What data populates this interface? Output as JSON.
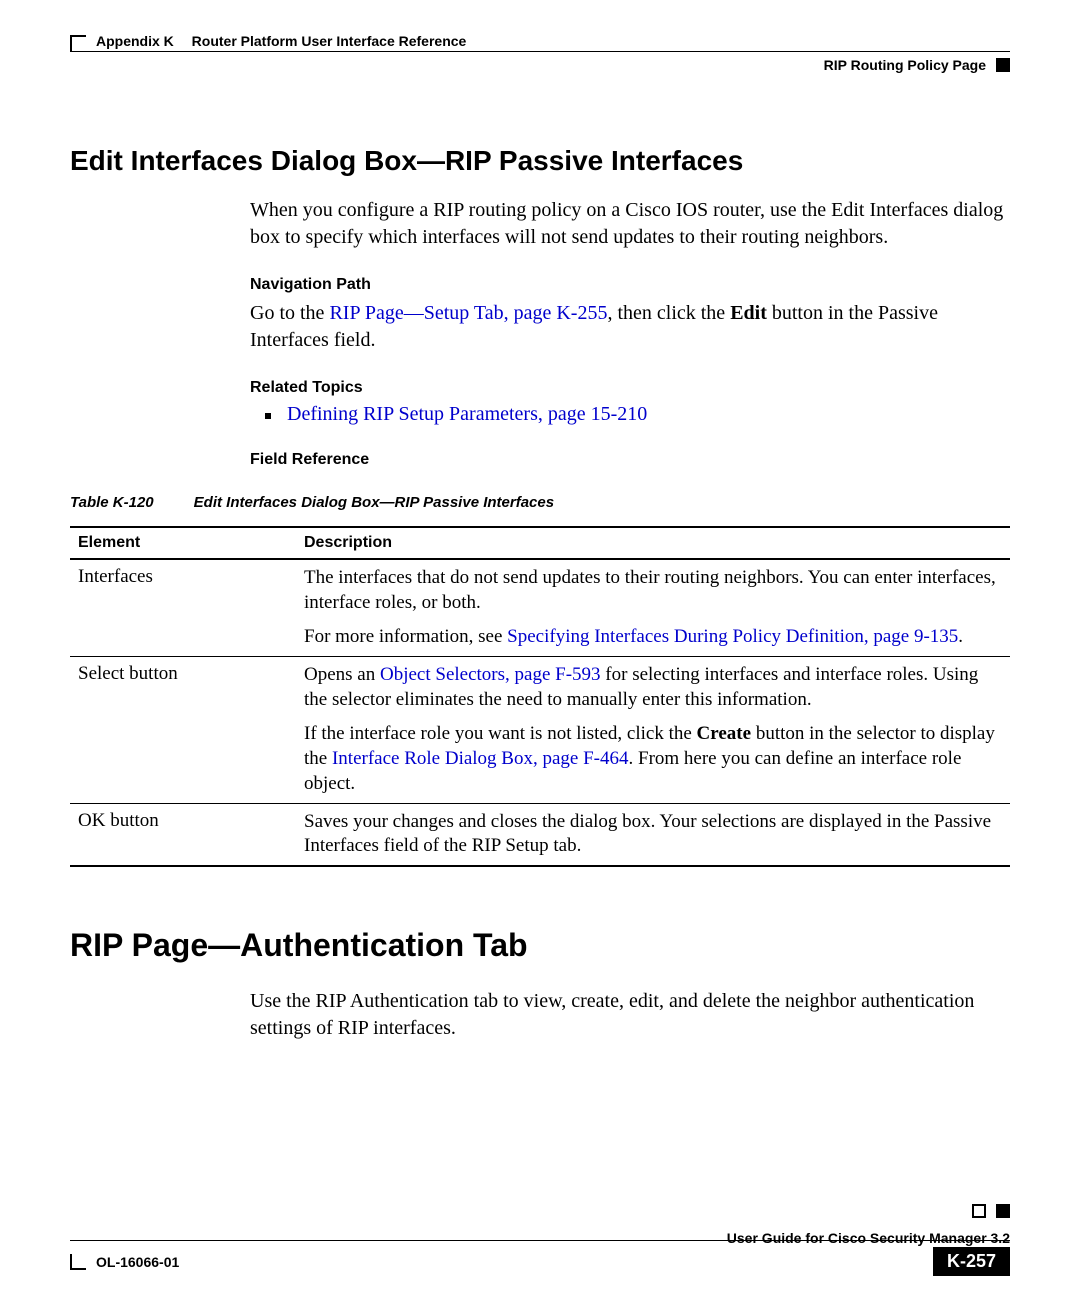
{
  "header": {
    "appendix": "Appendix K  Router Platform User Interface Reference",
    "section": "RIP Routing Policy Page"
  },
  "section1": {
    "heading": "Edit Interfaces Dialog Box—RIP Passive Interfaces",
    "intro": "When you configure a RIP routing policy on a Cisco IOS router, use the Edit Interfaces dialog box to specify which interfaces will not send updates to their routing neighbors.",
    "nav_path_label": "Navigation Path",
    "nav_prefix": "Go to the ",
    "nav_link": "RIP Page—Setup Tab, page K-255",
    "nav_mid": ", then click the ",
    "nav_bold": "Edit",
    "nav_suffix": " button in the Passive Interfaces field.",
    "related_label": "Related Topics",
    "related_link": "Defining RIP Setup Parameters, page 15-210",
    "field_ref_label": "Field Reference",
    "table_num": "Table K-120",
    "table_title": "Edit Interfaces Dialog Box—RIP Passive Interfaces"
  },
  "table": {
    "col1": "Element",
    "col2": "Description",
    "rows": [
      {
        "elem": "Interfaces",
        "p1": "The interfaces that do not send updates to their routing neighbors. You can enter interfaces, interface roles, or both.",
        "p2a": "For more information, see ",
        "p2link": "Specifying Interfaces During Policy Definition, page 9-135",
        "p2b": "."
      },
      {
        "elem": "Select button",
        "p1a": "Opens an ",
        "p1link": "Object Selectors, page F-593",
        "p1b": " for selecting interfaces and interface roles. Using the selector eliminates the need to manually enter this information.",
        "p2a": "If the interface role you want is not listed, click the ",
        "p2bold": "Create",
        "p2b": " button in the selector to display the ",
        "p2link": "Interface Role Dialog Box, page F-464",
        "p2c": ". From here you can define an interface role object."
      },
      {
        "elem": "OK button",
        "p1": "Saves your changes and closes the dialog box. Your selections are displayed in the Passive Interfaces field of the RIP Setup tab."
      }
    ]
  },
  "section2": {
    "heading": "RIP Page—Authentication Tab",
    "intro": "Use the RIP Authentication tab to view, create, edit, and delete the neighbor authentication settings of RIP interfaces."
  },
  "footer": {
    "guide": "User Guide for Cisco Security Manager 3.2",
    "doc_id": "OL-16066-01",
    "page": "K-257"
  }
}
